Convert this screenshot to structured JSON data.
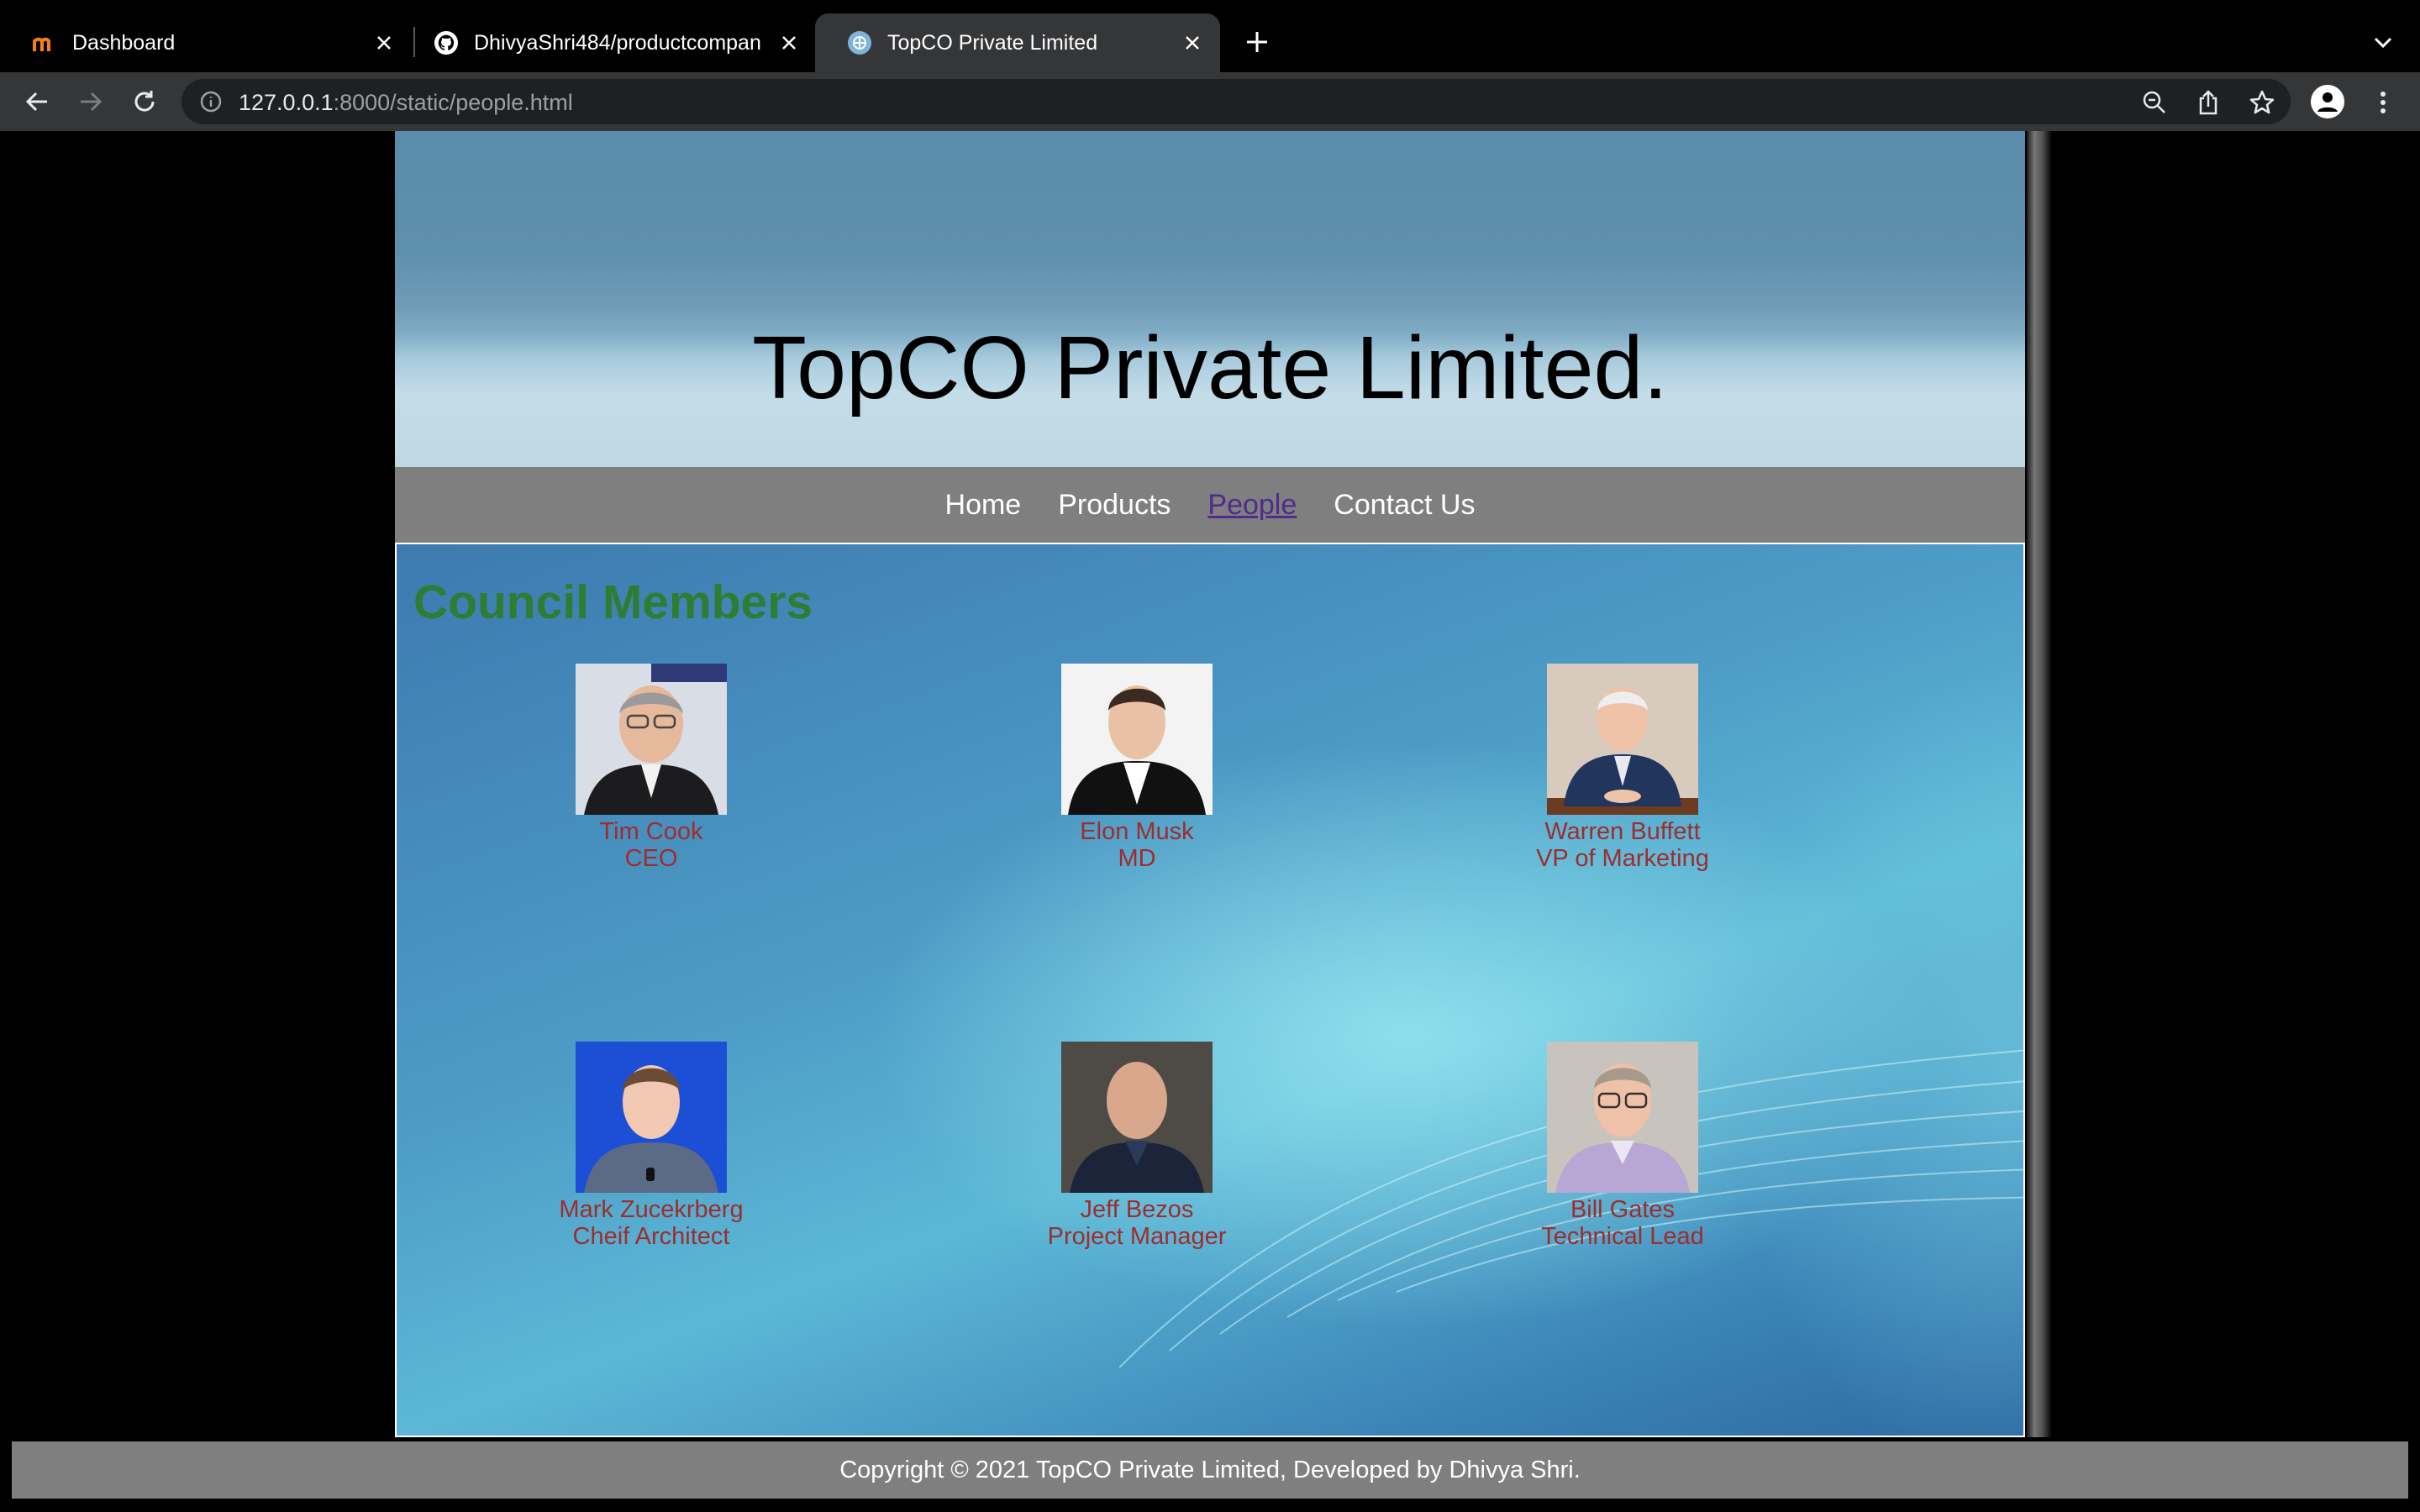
{
  "browser": {
    "tabs": [
      {
        "title": "Dashboard",
        "icon": "moodle-icon",
        "active": false
      },
      {
        "title": "DhivyaShri484/productcompan",
        "icon": "github-icon",
        "active": false
      },
      {
        "title": "TopCO Private Limited",
        "icon": "site-globe-icon",
        "active": true
      }
    ],
    "url_host": "127.0.0.1",
    "url_rest": ":8000/static/people.html"
  },
  "site": {
    "banner_title": "TopCO Private Limited.",
    "nav": [
      {
        "label": "Home",
        "current": false
      },
      {
        "label": "Products",
        "current": false
      },
      {
        "label": "People",
        "current": true
      },
      {
        "label": "Contact Us",
        "current": false
      }
    ],
    "section_heading": "Council Members",
    "members": [
      {
        "name": "Tim Cook",
        "role": "CEO"
      },
      {
        "name": "Elon Musk",
        "role": "MD"
      },
      {
        "name": "Warren Buffett",
        "role": "VP of Marketing"
      },
      {
        "name": "Mark Zucekrberg",
        "role": "Cheif Architect"
      },
      {
        "name": "Jeff Bezos",
        "role": "Project Manager"
      },
      {
        "name": "Bill Gates",
        "role": "Technical Lead"
      }
    ],
    "footer": "Copyright © 2021 TopCO Private Limited, Developed by Dhivya Shri."
  },
  "colors": {
    "heading": "#2e7d32",
    "member_text": "#a02c2c",
    "nav_bg": "#7f7f7f",
    "nav_current": "#4f2c8c"
  }
}
